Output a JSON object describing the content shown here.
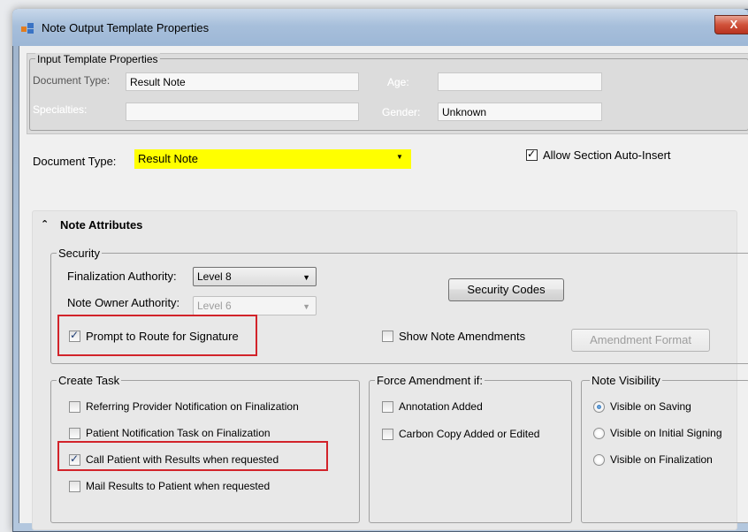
{
  "window": {
    "title": "Note Output Template Properties",
    "close_label": "X"
  },
  "input_template": {
    "group_label": "Input Template Properties",
    "document_type_label": "Document Type:",
    "document_type_value": "Result Note",
    "age_label": "Age:",
    "age_value": "",
    "specialties_label": "Specialties:",
    "specialties_value": "",
    "gender_label": "Gender:",
    "gender_value": "Unknown"
  },
  "document_type": {
    "label": "Document Type:",
    "value": "Result Note",
    "highlight_color": "#ffff00"
  },
  "allow_auto_insert": {
    "label": "Allow Section Auto-Insert",
    "checked": true
  },
  "note_attributes": {
    "header": "Note Attributes",
    "collapse_icon": "double-chevron-up-icon"
  },
  "security": {
    "group_label": "Security",
    "finalization_label": "Finalization Authority:",
    "finalization_value": "Level 8",
    "owner_label": "Note Owner Authority:",
    "owner_value": "Level 6",
    "security_codes_button": "Security Codes",
    "prompt_route_label": "Prompt to Route for Signature",
    "prompt_route_checked": true,
    "show_amendments_label": "Show Note Amendments",
    "show_amendments_checked": false,
    "amendment_format_button": "Amendment Format"
  },
  "create_task": {
    "group_label": "Create Task",
    "items": [
      {
        "label": "Referring Provider Notification on Finalization",
        "checked": false
      },
      {
        "label": "Patient Notification Task on Finalization",
        "checked": false
      },
      {
        "label": "Call Patient with Results when requested",
        "checked": true
      },
      {
        "label": "Mail Results to Patient when requested",
        "checked": false
      }
    ]
  },
  "force_amendment": {
    "group_label": "Force Amendment if:",
    "items": [
      {
        "label": "Annotation Added",
        "checked": false
      },
      {
        "label": "Carbon Copy Added or Edited",
        "checked": false
      }
    ]
  },
  "note_visibility": {
    "group_label": "Note Visibility",
    "items": [
      {
        "label": "Visible on Saving",
        "selected": true
      },
      {
        "label": "Visible on Initial Signing",
        "selected": false
      },
      {
        "label": "Visible on Finalization",
        "selected": false
      }
    ]
  },
  "annotation_color": "#d2232a"
}
